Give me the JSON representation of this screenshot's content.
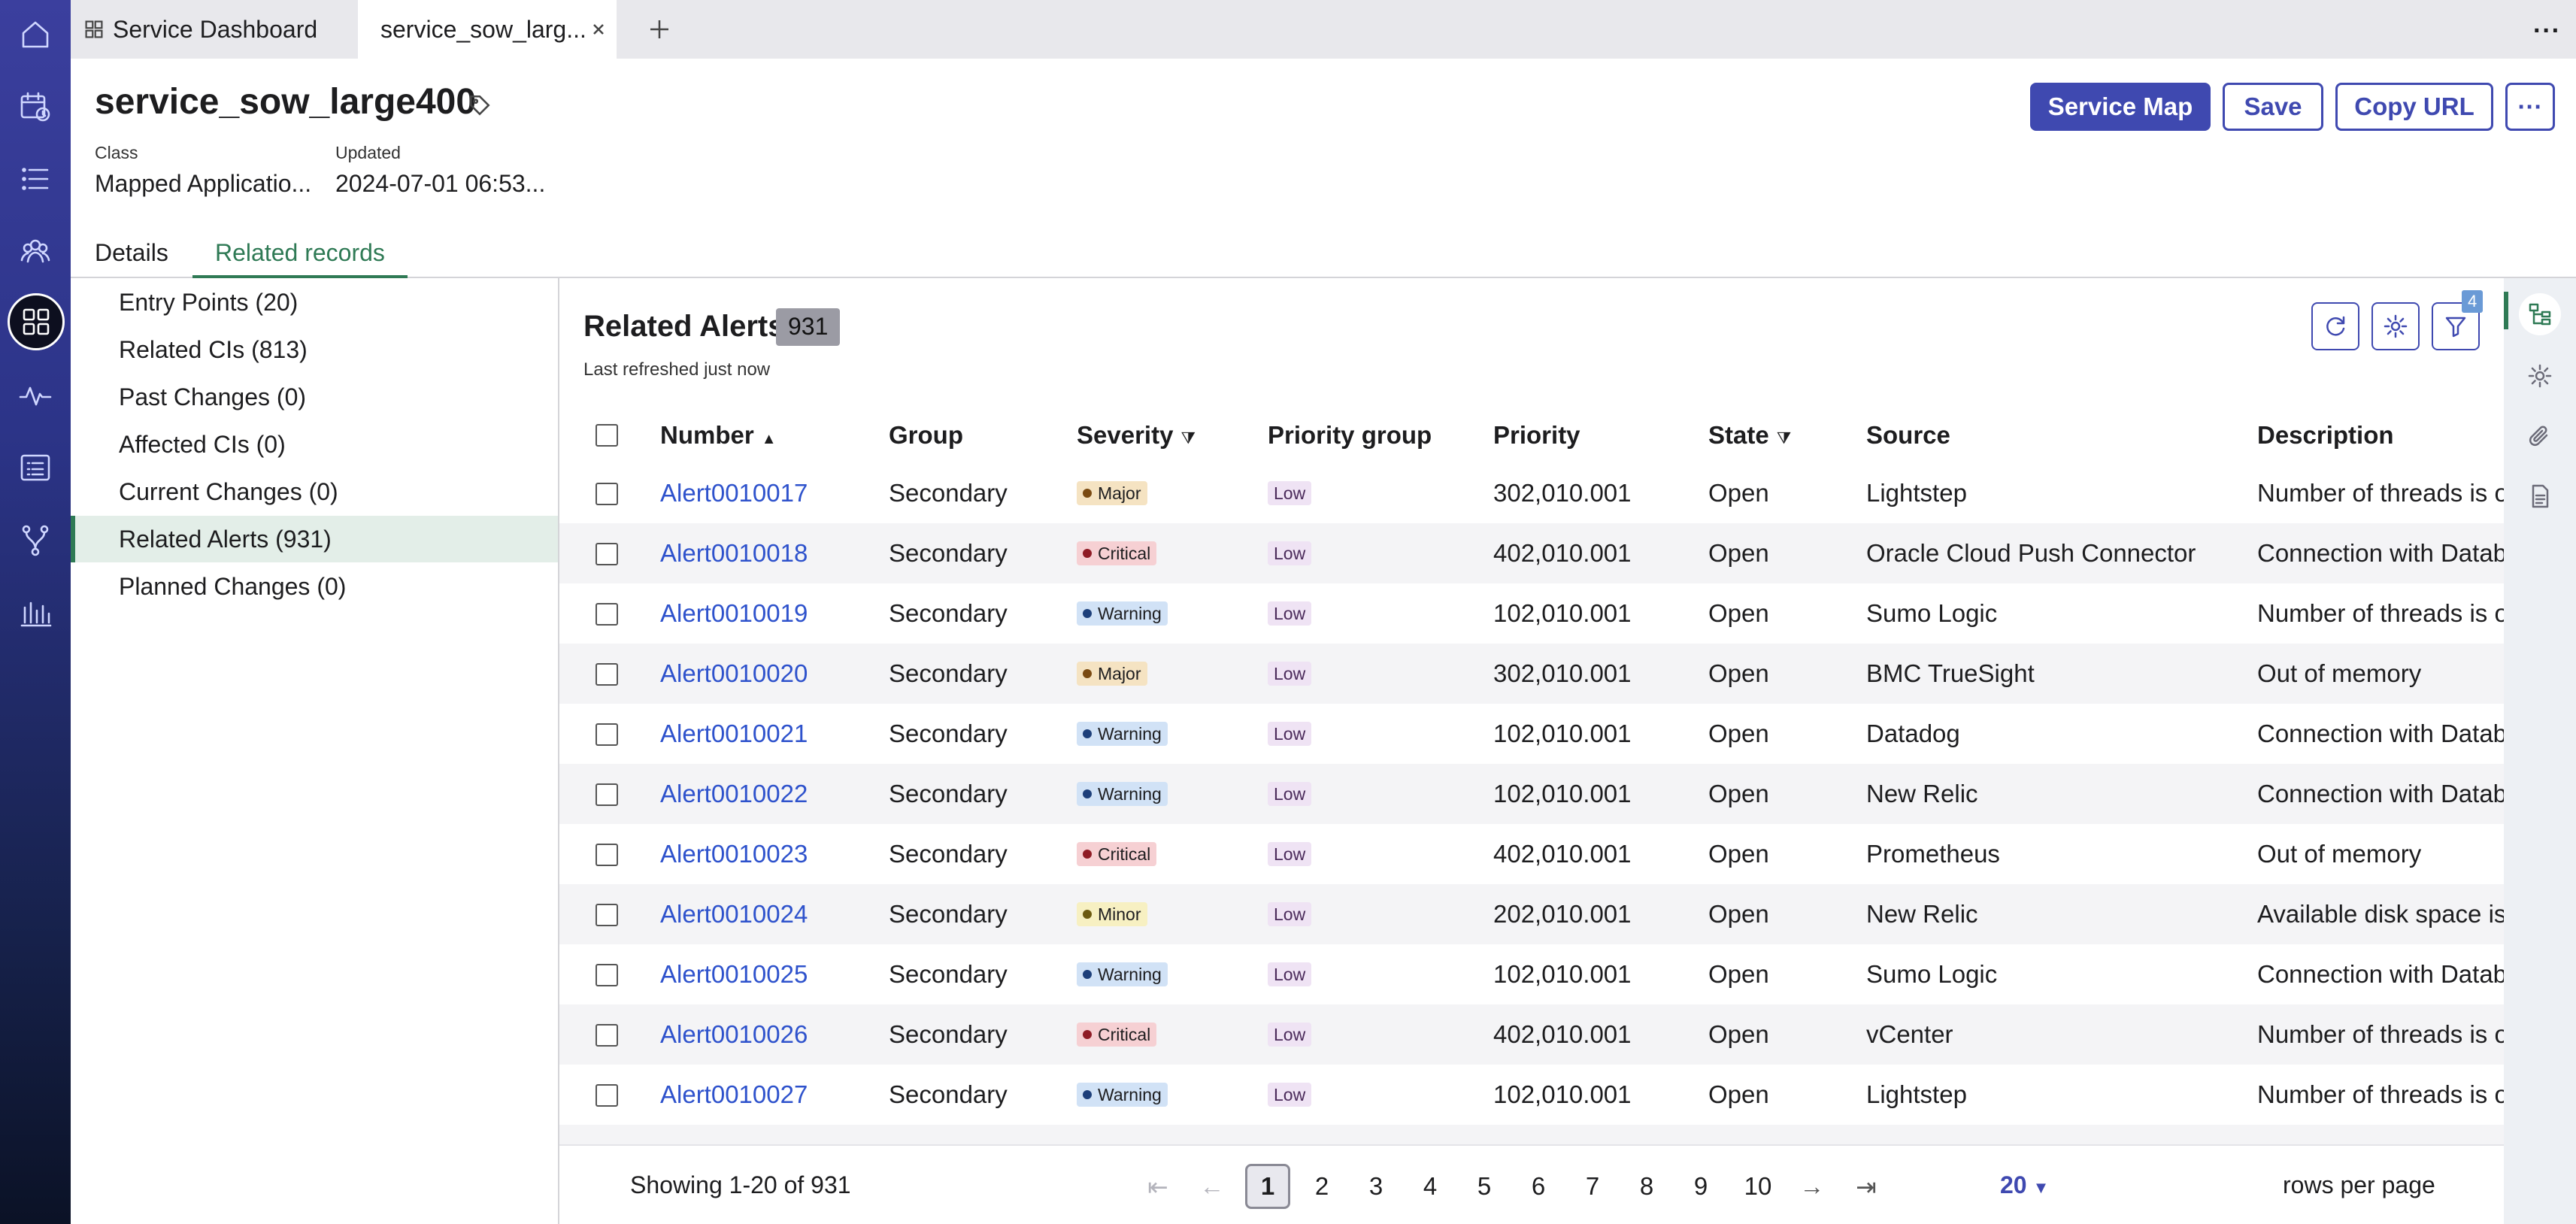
{
  "tabs": [
    {
      "label": "Service Dashboard"
    },
    {
      "label": "service_sow_larg..."
    }
  ],
  "record": {
    "title": "service_sow_large400",
    "class_label": "Class",
    "class_value": "Mapped Applicatio...",
    "updated_label": "Updated",
    "updated_value": "2024-07-01 06:53..."
  },
  "actions": {
    "service_map": "Service Map",
    "save": "Save",
    "copy_url": "Copy URL",
    "more": "···"
  },
  "record_tabs": [
    {
      "label": "Details"
    },
    {
      "label": "Related records"
    }
  ],
  "related_nav": [
    {
      "label": "Entry Points (20)"
    },
    {
      "label": "Related CIs (813)"
    },
    {
      "label": "Past Changes (0)"
    },
    {
      "label": "Affected CIs (0)"
    },
    {
      "label": "Current Changes (0)"
    },
    {
      "label": "Related Alerts (931)"
    },
    {
      "label": "Planned Changes (0)"
    }
  ],
  "list": {
    "title": "Related Alerts",
    "count": "931",
    "refreshed": "Last refreshed just now",
    "filter_badge": "4",
    "columns": [
      "Number",
      "Group",
      "Severity",
      "Priority group",
      "Priority",
      "State",
      "Source",
      "Description"
    ],
    "rows": [
      {
        "number": "Alert0010017",
        "group": "Secondary",
        "severity": "Major",
        "pgroup": "Low",
        "priority": "302,010.001",
        "state": "Open",
        "source": "Lightstep",
        "description": "Number of threads is over the limit"
      },
      {
        "number": "Alert0010018",
        "group": "Secondary",
        "severity": "Critical",
        "pgroup": "Low",
        "priority": "402,010.001",
        "state": "Open",
        "source": "Oracle Cloud Push Connector",
        "description": "Connection with Database failed"
      },
      {
        "number": "Alert0010019",
        "group": "Secondary",
        "severity": "Warning",
        "pgroup": "Low",
        "priority": "102,010.001",
        "state": "Open",
        "source": "Sumo Logic",
        "description": "Number of threads is over the limit"
      },
      {
        "number": "Alert0010020",
        "group": "Secondary",
        "severity": "Major",
        "pgroup": "Low",
        "priority": "302,010.001",
        "state": "Open",
        "source": "BMC TrueSight",
        "description": "Out of memory"
      },
      {
        "number": "Alert0010021",
        "group": "Secondary",
        "severity": "Warning",
        "pgroup": "Low",
        "priority": "102,010.001",
        "state": "Open",
        "source": "Datadog",
        "description": "Connection with Database failed"
      },
      {
        "number": "Alert0010022",
        "group": "Secondary",
        "severity": "Warning",
        "pgroup": "Low",
        "priority": "102,010.001",
        "state": "Open",
        "source": "New Relic",
        "description": "Connection with Database failed"
      },
      {
        "number": "Alert0010023",
        "group": "Secondary",
        "severity": "Critical",
        "pgroup": "Low",
        "priority": "402,010.001",
        "state": "Open",
        "source": "Prometheus",
        "description": "Out of memory"
      },
      {
        "number": "Alert0010024",
        "group": "Secondary",
        "severity": "Minor",
        "pgroup": "Low",
        "priority": "202,010.001",
        "state": "Open",
        "source": "New Relic",
        "description": "Available disk space is below"
      },
      {
        "number": "Alert0010025",
        "group": "Secondary",
        "severity": "Warning",
        "pgroup": "Low",
        "priority": "102,010.001",
        "state": "Open",
        "source": "Sumo Logic",
        "description": "Connection with Database failed"
      },
      {
        "number": "Alert0010026",
        "group": "Secondary",
        "severity": "Critical",
        "pgroup": "Low",
        "priority": "402,010.001",
        "state": "Open",
        "source": "vCenter",
        "description": "Number of threads is over the limit"
      },
      {
        "number": "Alert0010027",
        "group": "Secondary",
        "severity": "Warning",
        "pgroup": "Low",
        "priority": "102,010.001",
        "state": "Open",
        "source": "Lightstep",
        "description": "Number of threads is over the limit"
      }
    ]
  },
  "pagination": {
    "showing": "Showing 1-20 of 931",
    "pages": [
      "1",
      "2",
      "3",
      "4",
      "5",
      "6",
      "7",
      "8",
      "9",
      "10"
    ],
    "current": "1",
    "rows_value": "20",
    "rows_label": "rows per page"
  },
  "severity_colors": {
    "Major": "#f5e3c2",
    "Critical": "#f6d0d3",
    "Warning": "#d1e2f6",
    "Minor": "#f7f0c2"
  },
  "severity_dot": {
    "Major": "#7a4a12",
    "Critical": "#8f1b25",
    "Warning": "#1d3f7a",
    "Minor": "#6c5a10"
  },
  "accent": "#3f49b0",
  "link_color": "#2e52cc"
}
